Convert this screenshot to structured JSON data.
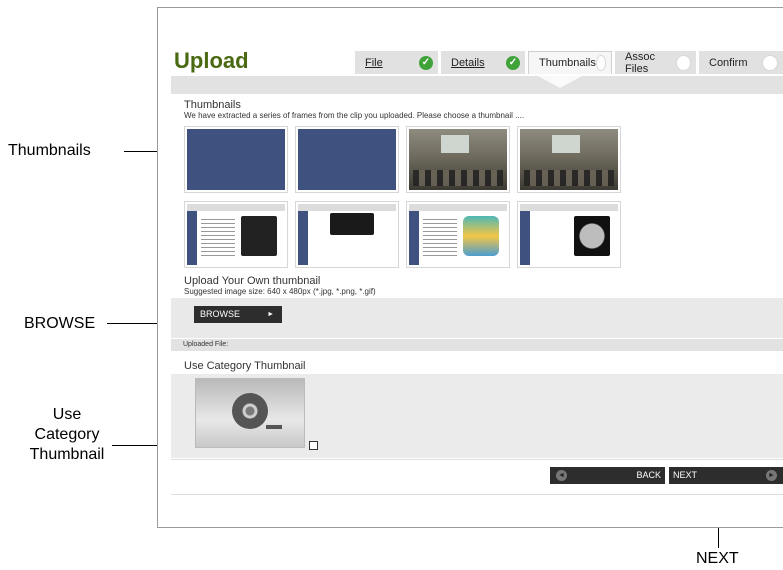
{
  "annotations": {
    "thumbnails": "Thumbnails",
    "browse": "BROWSE",
    "category_line1": "Use",
    "category_line2": "Category",
    "category_line3": "Thumbnail",
    "next": "NEXT"
  },
  "page": {
    "title": "Upload"
  },
  "tabs": [
    {
      "label": "File",
      "status": "check"
    },
    {
      "label": "Details",
      "status": "check"
    },
    {
      "label": "Thumbnails",
      "status": "circle"
    },
    {
      "label": "Assoc Files",
      "status": "circle"
    },
    {
      "label": "Confirm",
      "status": "circle"
    }
  ],
  "thumbnails_section": {
    "title": "Thumbnails",
    "description": "We have extracted a series of frames from the clip you uploaded. Please choose a thumbnail ...."
  },
  "upload_section": {
    "title": "Upload Your Own thumbnail",
    "hint": "Suggested image size: 640 x 480px (*.jpg, *.png, *.gif)",
    "browse_label": "BROWSE",
    "browse_arrow": "►",
    "uploaded_label": "Uploaded File:"
  },
  "category_section": {
    "title": "Use Category Thumbnail",
    "icon": "film-reel-icon"
  },
  "buttons": {
    "back_label": "BACK",
    "next_label": "NEXT",
    "back_icon": "◄",
    "next_icon": "►"
  },
  "colors": {
    "title_green": "#4a6a12",
    "check_green": "#3fa33a",
    "thumb_blue": "#3f517e",
    "button_dark": "#2d2d2d"
  }
}
